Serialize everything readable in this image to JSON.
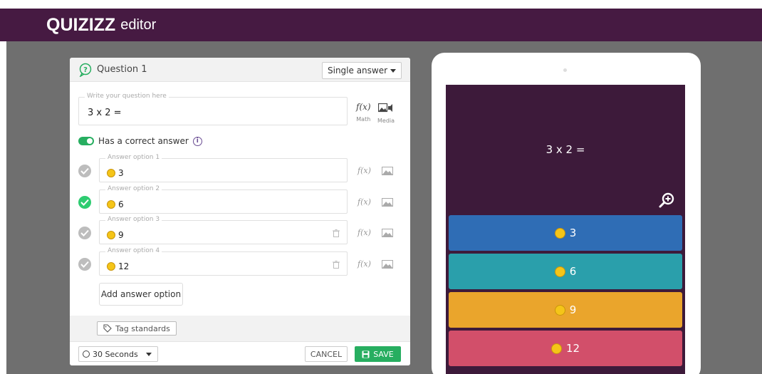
{
  "header": {
    "logo": "QUIZIZZ",
    "subtitle": "editor"
  },
  "editor": {
    "question_label": "Question 1",
    "answer_type": "Single answer",
    "question_legend": "Write your question here",
    "question_text": "3 x 2 =",
    "math_label": "Math",
    "media_label": "Media",
    "math_glyph": "f(x)",
    "has_correct_answer_label": "Has a correct answer",
    "answers": [
      {
        "legend": "Answer option 1",
        "text": "3",
        "correct": false
      },
      {
        "legend": "Answer option 2",
        "text": "6",
        "correct": true
      },
      {
        "legend": "Answer option 3",
        "text": "9",
        "correct": false
      },
      {
        "legend": "Answer option 4",
        "text": "12",
        "correct": false
      }
    ],
    "add_answer_label": "Add answer option",
    "tag_standards_label": "Tag standards",
    "time_limit": "30 Seconds",
    "cancel_label": "CANCEL",
    "save_label": "SAVE"
  },
  "preview": {
    "question_text": "3 x 2 =",
    "options": [
      {
        "text": "3",
        "color": "#2f6db5"
      },
      {
        "text": "6",
        "color": "#2a9fab"
      },
      {
        "text": "9",
        "color": "#eaa52c"
      },
      {
        "text": "12",
        "color": "#d24f6a"
      }
    ]
  },
  "colors": {
    "brand": "#461a42",
    "accent": "#27ae60",
    "stage": "#6f6f6f"
  }
}
